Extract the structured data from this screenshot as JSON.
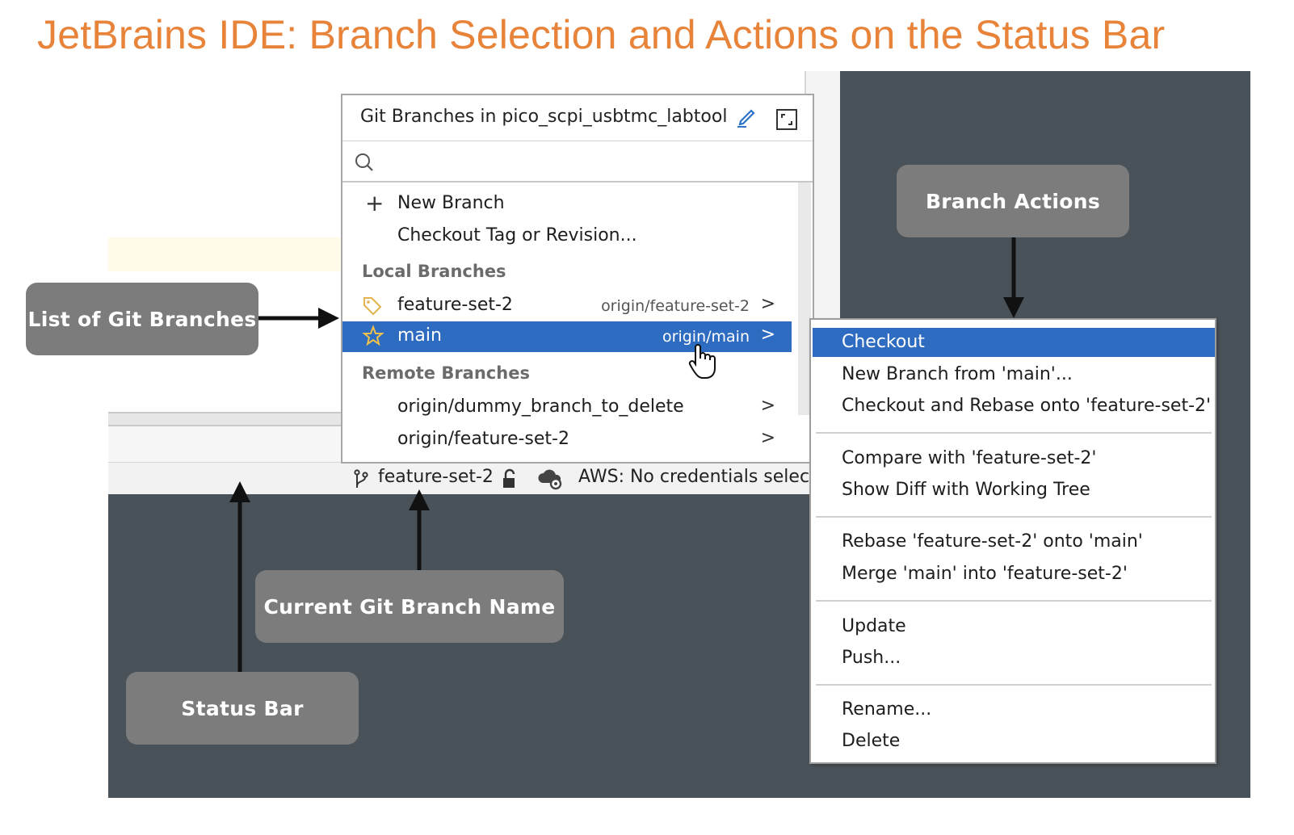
{
  "title": "JetBrains IDE: Branch Selection and Actions on the Status Bar",
  "popup": {
    "title": "Git Branches in pico_scpi_usbtmc_labtool",
    "search_placeholder": "",
    "actions": [
      {
        "label": "New Branch",
        "icon": "plus-icon"
      },
      {
        "label": "Checkout Tag or Revision..."
      }
    ],
    "local_header": "Local Branches",
    "local": [
      {
        "label": "feature-set-2",
        "upstream": "origin/feature-set-2",
        "icon": "tag-icon"
      },
      {
        "label": "main",
        "upstream": "origin/main",
        "icon": "star-icon",
        "selected": true
      }
    ],
    "remote_header": "Remote Branches",
    "remote": [
      {
        "label": "origin/dummy_branch_to_delete"
      },
      {
        "label": "origin/feature-set-2"
      }
    ],
    "chevron": ">"
  },
  "statusbar": {
    "branch": "feature-set-2",
    "aws": "AWS: No credentials selecte"
  },
  "context_menu": {
    "items": [
      "Checkout",
      "New Branch from 'main'...",
      "Checkout and Rebase onto 'feature-set-2'",
      "Compare with 'feature-set-2'",
      "Show Diff with Working Tree",
      "Rebase 'feature-set-2' onto 'main'",
      "Merge 'main' into 'feature-set-2'",
      "Update",
      "Push...",
      "Rename...",
      "Delete"
    ],
    "selected_index": 0
  },
  "callouts": {
    "list_of_branches": "List of Git Branches",
    "branch_actions": "Branch Actions",
    "current_branch": "Current Git Branch Name",
    "status_bar": "Status Bar"
  },
  "colors": {
    "title": "#e8833a",
    "selection": "#2e6cc1",
    "callout": "#7c7c7c",
    "ide_dark": "#4a5259"
  }
}
